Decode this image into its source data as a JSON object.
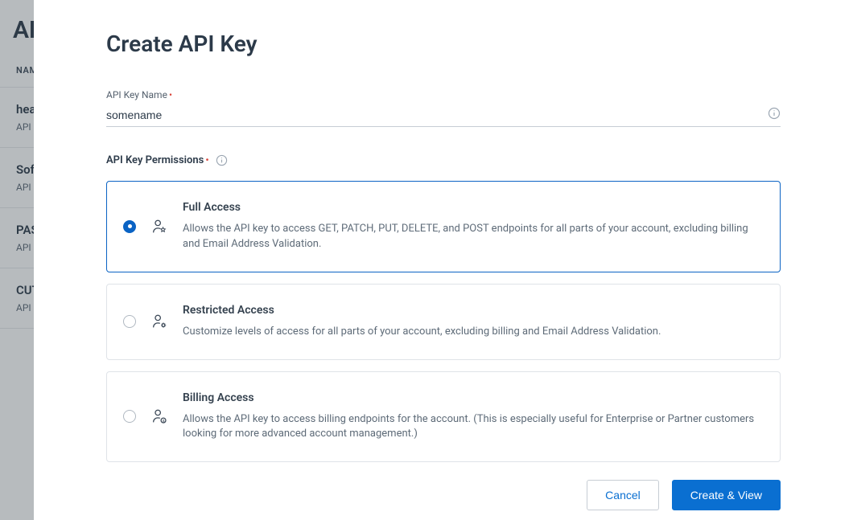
{
  "background": {
    "page_heading": "AP",
    "column_header": "NAM",
    "rows": [
      {
        "title": "hea",
        "sub": "API K"
      },
      {
        "title": "Sof",
        "sub": "API K"
      },
      {
        "title": "PAS",
        "sub": "API K"
      },
      {
        "title": "CUT",
        "sub": "API K"
      }
    ]
  },
  "modal": {
    "title": "Create API Key",
    "name_label": "API Key Name",
    "name_value": "somename",
    "perm_label": "API Key Permissions",
    "options": {
      "full": {
        "title": "Full Access",
        "desc": "Allows the API key to access GET, PATCH, PUT, DELETE, and POST endpoints for all parts of your account, excluding billing and Email Address Validation."
      },
      "restricted": {
        "title": "Restricted Access",
        "desc": "Customize levels of access for all parts of your account, excluding billing and Email Address Validation."
      },
      "billing": {
        "title": "Billing Access",
        "desc": "Allows the API key to access billing endpoints for the account. (This is especially useful for Enterprise or Partner customers looking for more advanced account management.)"
      }
    },
    "cancel_label": "Cancel",
    "submit_label": "Create & View"
  }
}
